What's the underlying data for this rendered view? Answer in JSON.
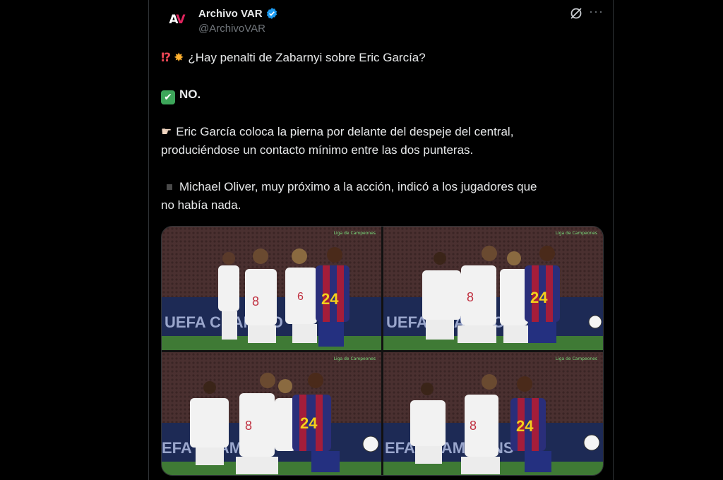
{
  "tweet": {
    "author_name": "Archivo VAR",
    "author_handle": "@ArchivoVAR",
    "avatar_text": "AV",
    "line1": "¿Hay penalti de Zabarnyi sobre Eric García?",
    "line2": "NO.",
    "line3a": "Eric García coloca la pierna por delante del despeje del central,",
    "line3b": "produciéndose un contacto mínimo entre las dos punteras.",
    "line4a": "Michael Oliver, muy próximo a la acción, indicó a los jugadores que",
    "line4b": "no había nada.",
    "more_label": "···"
  },
  "media": {
    "frames": [
      {
        "banner": "UEFA CHAMPIO",
        "broadcast": "Liga de Campeones"
      },
      {
        "banner": "UEFA CHAMPIO",
        "broadcast": "Liga de Campeones"
      },
      {
        "banner": "EFA CHAMPIO",
        "broadcast": "Liga de Campeones"
      },
      {
        "banner": "EFA CHAMPIONS",
        "broadcast": "Liga de Campeones"
      }
    ],
    "player_numbers": [
      "8",
      "6",
      "24"
    ]
  },
  "colors": {
    "background": "#000000",
    "text": "#e7e9ea",
    "secondary_text": "#71767b",
    "verified": "#1d9bf0",
    "border": "#2f3336"
  },
  "icons": [
    "verified-badge-icon",
    "grok-icon",
    "more-icon",
    "interrobang-emoji",
    "collision-emoji",
    "check-mark-emoji",
    "pointing-hand-emoji",
    "black-square-emoji"
  ]
}
